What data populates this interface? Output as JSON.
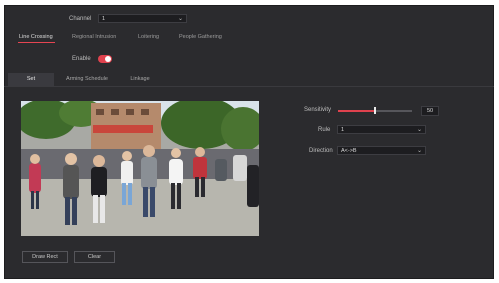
{
  "channel": {
    "label": "Channel",
    "value": "1"
  },
  "tabs": [
    {
      "label": "Line Crossing",
      "active": true
    },
    {
      "label": "Regional Intrusion",
      "active": false
    },
    {
      "label": "Loitering",
      "active": false
    },
    {
      "label": "People Gathering",
      "active": false
    }
  ],
  "enable": {
    "label": "Enable",
    "on": true
  },
  "subtabs": [
    {
      "label": "Set",
      "active": true
    },
    {
      "label": "Arming Schedule",
      "active": false
    },
    {
      "label": "Linkage",
      "active": false
    }
  ],
  "video": {
    "description_icon": "camera-feed"
  },
  "sensitivity": {
    "label": "Sensitivity",
    "value": "50",
    "level": 0.5
  },
  "rule": {
    "label": "Rule",
    "value": "1"
  },
  "direction": {
    "label": "Direction",
    "value": "A<->B"
  },
  "buttons": {
    "draw_rect": "Draw Rect",
    "clear": "Clear"
  },
  "colors": {
    "accent": "#e0424e",
    "panel": "#2b2b2e"
  }
}
